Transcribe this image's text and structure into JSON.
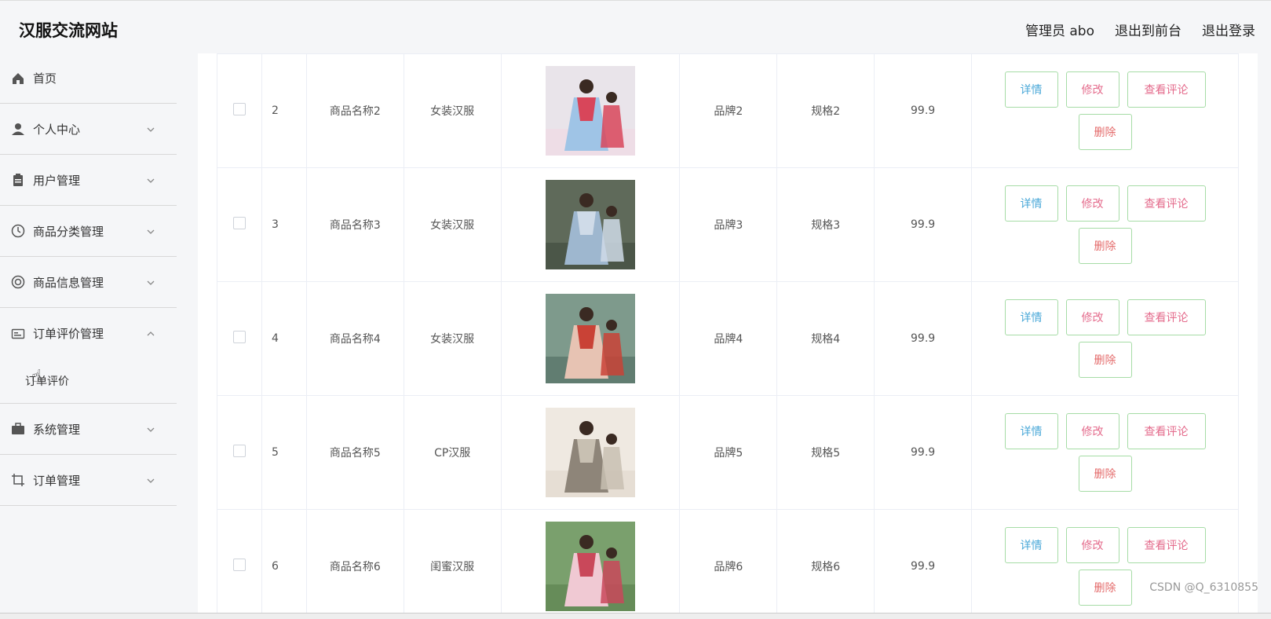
{
  "header": {
    "site_title": "汉服交流网站",
    "admin_label": "管理员 abo",
    "exit_front": "退出到前台",
    "logout": "退出登录"
  },
  "sidebar": {
    "items": [
      {
        "label": "首页",
        "icon": "home-icon"
      },
      {
        "label": "个人中心",
        "icon": "user-icon"
      },
      {
        "label": "用户管理",
        "icon": "clipboard-icon"
      },
      {
        "label": "商品分类管理",
        "icon": "clock-icon"
      },
      {
        "label": "商品信息管理",
        "icon": "lifebuoy-icon"
      },
      {
        "label": "订单评价管理",
        "icon": "message-icon"
      },
      {
        "label": "系统管理",
        "icon": "briefcase-icon"
      },
      {
        "label": "订单管理",
        "icon": "crop-icon"
      }
    ],
    "sub_item": "订单评价"
  },
  "table": {
    "rows": [
      {
        "id": "2",
        "name": "商品名称2",
        "category": "女装汉服",
        "brand": "品牌2",
        "spec": "规格2",
        "price": "99.9"
      },
      {
        "id": "3",
        "name": "商品名称3",
        "category": "女装汉服",
        "brand": "品牌3",
        "spec": "规格3",
        "price": "99.9"
      },
      {
        "id": "4",
        "name": "商品名称4",
        "category": "女装汉服",
        "brand": "品牌4",
        "spec": "规格4",
        "price": "99.9"
      },
      {
        "id": "5",
        "name": "商品名称5",
        "category": "CP汉服",
        "brand": "品牌5",
        "spec": "规格5",
        "price": "99.9"
      },
      {
        "id": "6",
        "name": "商品名称6",
        "category": "闺蜜汉服",
        "brand": "品牌6",
        "spec": "规格6",
        "price": "99.9"
      }
    ]
  },
  "buttons": {
    "detail": "详情",
    "edit": "修改",
    "review": "查看评论",
    "delete": "删除"
  },
  "watermark": "CSDN @Q_6310855",
  "colors": {
    "button_border": "#a6dca6",
    "detail_text": "#4aa8d8",
    "edit_text": "#e46b8c",
    "delete_text": "#e46b6b"
  }
}
